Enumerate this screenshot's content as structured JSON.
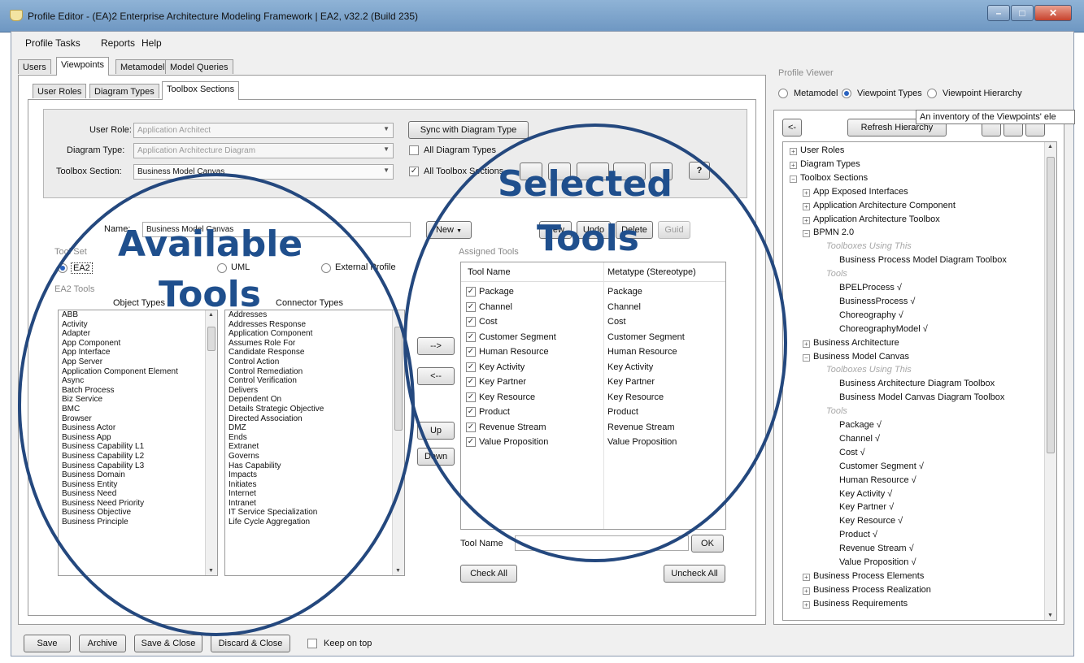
{
  "window": {
    "title": "Profile Editor - (EA)2 Enterprise Architecture Modeling Framework | EA2, v32.2 (Build 235)"
  },
  "menu": [
    "Profile Tasks",
    "Reports",
    "Help"
  ],
  "main_tabs": [
    "Users",
    "Viewpoints",
    "Metamodel",
    "Model Queries"
  ],
  "sub_tabs": [
    "User Roles",
    "Diagram Types",
    "Toolbox Sections"
  ],
  "filters": {
    "user_role_label": "User Role:",
    "user_role_value": "Application Architect",
    "diagram_type_label": "Diagram Type:",
    "diagram_type_value": "Application Architecture Diagram",
    "toolbox_section_label": "Toolbox Section:",
    "toolbox_section_value": "Business Model Canvas",
    "sync_button": "Sync with Diagram Type",
    "all_diagram_types": "All Diagram Types",
    "all_toolbox_sections": "All Toolbox Sections",
    "help_button": "?"
  },
  "editor": {
    "name_label": "Name:",
    "name_value": "Business Model Canvas",
    "new_dropdown": "New",
    "new_button": "New",
    "undo_button": "Undo",
    "delete_button": "Delete",
    "guid_button": "Guid"
  },
  "toolset": {
    "label": "Tool Set",
    "options": [
      "EA2",
      "UML",
      "External Profile"
    ],
    "selected": "EA2"
  },
  "ea2_tools": {
    "label": "EA2 Tools",
    "object_types_header": "Object Types",
    "connector_types_header": "Connector Types",
    "object_types": [
      "ABB",
      "Activity",
      "Adapter",
      "App Component",
      "App Interface",
      "App Server",
      "Application Component Element",
      "Async",
      "Batch Process",
      "Biz Service",
      "BMC",
      "Browser",
      "Business Actor",
      "Business App",
      "Business Capability L1",
      "Business Capability L2",
      "Business Capability L3",
      "Business Domain",
      "Business Entity",
      "Business Need",
      "Business Need Priority",
      "Business Objective",
      "Business Principle"
    ],
    "connector_types": [
      "Addresses",
      "Addresses Response",
      "Application Component",
      "Assumes Role For",
      "Candidate Response",
      "Control Action",
      "Control Remediation",
      "Control Verification",
      "Delivers",
      "Dependent On",
      "Details Strategic Objective",
      "Directed Association",
      "DMZ",
      "Ends",
      "Extranet",
      "Governs",
      "Has Capability",
      "Impacts",
      "Initiates",
      "Internet",
      "Intranet",
      "IT Service Specialization",
      "Life Cycle Aggregation"
    ]
  },
  "transfer": {
    "add": "-->",
    "remove": "<--",
    "up": "Up",
    "down": "Down"
  },
  "assigned": {
    "label": "Assigned Tools",
    "col_name": "Tool Name",
    "col_meta": "Metatype (Stereotype)",
    "rows": [
      {
        "name": "Package",
        "meta": "Package"
      },
      {
        "name": "Channel",
        "meta": "Channel"
      },
      {
        "name": "Cost",
        "meta": "Cost"
      },
      {
        "name": "Customer Segment",
        "meta": "Customer Segment"
      },
      {
        "name": "Human Resource",
        "meta": "Human Resource"
      },
      {
        "name": "Key Activity",
        "meta": "Key Activity"
      },
      {
        "name": "Key Partner",
        "meta": "Key Partner"
      },
      {
        "name": "Key Resource",
        "meta": "Key Resource"
      },
      {
        "name": "Product",
        "meta": "Product"
      },
      {
        "name": "Revenue Stream",
        "meta": "Revenue Stream"
      },
      {
        "name": "Value Proposition",
        "meta": "Value Proposition"
      }
    ],
    "tool_name_label": "Tool Name",
    "ok_button": "OK",
    "check_all": "Check All",
    "uncheck_all": "Uncheck All"
  },
  "bottom": {
    "save": "Save",
    "archive": "Archive",
    "save_close": "Save & Close",
    "discard_close": "Discard & Close",
    "keep_on_top": "Keep on top"
  },
  "viewer": {
    "label": "Profile Viewer",
    "options": [
      "Metamodel",
      "Viewpoint Types",
      "Viewpoint Hierarchy"
    ],
    "selected": "Viewpoint Types",
    "tooltip": "An inventory of the Viewpoints' ele",
    "back_button": "<-",
    "refresh_button": "Refresh Hierarchy",
    "tree": [
      "User Roles",
      "Diagram Types",
      "Toolbox Sections",
      "App Exposed Interfaces",
      "Application Architecture Component",
      "Application Architecture Toolbox",
      "BPMN 2.0",
      "Toolboxes Using This",
      "Business Process Model Diagram Toolbox",
      "Tools",
      "BPELProcess √",
      "BusinessProcess √",
      "Choreography √",
      "ChoreographyModel √",
      "Business Architecture",
      "Business Model Canvas",
      "Toolboxes Using This",
      "Business Architecture Diagram Toolbox",
      "Business Model Canvas Diagram Toolbox",
      "Tools",
      "Package √",
      "Channel √",
      "Cost √",
      "Customer Segment √",
      "Human Resource √",
      "Key Activity √",
      "Key Partner √",
      "Key Resource √",
      "Product √",
      "Revenue Stream √",
      "Value Proposition √",
      "Business Process Elements",
      "Business Process Realization",
      "Business Requirements"
    ]
  },
  "annotations": {
    "available_1": "Available",
    "available_2": "Tools",
    "selected_1": "Selected",
    "selected_2": "Tools"
  },
  "colors": {
    "annotation": "#24487e",
    "titlebar": "#7fa3cb",
    "accent": "#2a63c0"
  }
}
